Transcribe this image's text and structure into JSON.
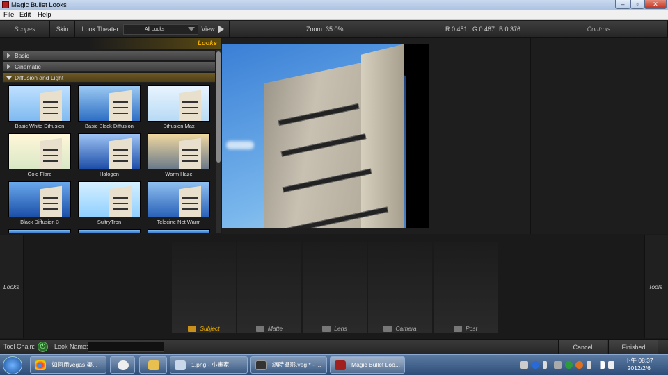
{
  "window": {
    "title": "Magic Bullet Looks"
  },
  "menu": [
    "File",
    "Edit",
    "Help"
  ],
  "toolbar": {
    "scopes": "Scopes",
    "skin": "Skin",
    "look_theater": "Look Theater",
    "all_looks": "All Looks",
    "view": "View",
    "zoom": "Zoom:  35.0%",
    "r": "R 0.451",
    "g": "G 0.467",
    "b": "B 0.376",
    "controls": "Controls"
  },
  "looks": {
    "header": "Looks",
    "categories": [
      "Basic",
      "Cinematic",
      "Diffusion and Light"
    ],
    "presets": [
      "Basic White Diffusion",
      "Basic Black Diffusion",
      "Diffusion Max",
      "Gold Flare",
      "Halogen",
      "Warm Haze",
      "Black Diffusion 3",
      "SultryTron",
      "Telecine Net Warm"
    ]
  },
  "bottom": {
    "looks": "Looks",
    "tools": "Tools",
    "tabs": [
      "Subject",
      "Matte",
      "Lens",
      "Camera",
      "Post"
    ]
  },
  "status": {
    "tool_chain": "Tool Chain:",
    "look_name": "Look Name:",
    "cancel": "Cancel",
    "finished": "Finished"
  },
  "taskbar": {
    "items": [
      "如何用vegas 渠...",
      "1.png - 小畫家",
      "縮時攝影.veg * - ...",
      "Magic Bullet Loo..."
    ],
    "time": "下午 08:37",
    "date": "2012/2/6"
  }
}
